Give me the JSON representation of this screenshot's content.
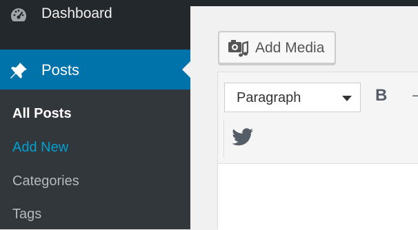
{
  "sidebar": {
    "dashboard": {
      "label": "Dashboard",
      "icon": "dashboard-gauge-icon"
    },
    "posts": {
      "label": "Posts",
      "icon": "pushpin-icon"
    },
    "submenu": [
      {
        "label": "All Posts",
        "state": "current"
      },
      {
        "label": "Add New",
        "state": "hover"
      },
      {
        "label": "Categories",
        "state": "normal"
      },
      {
        "label": "Tags",
        "state": "normal"
      }
    ]
  },
  "editor": {
    "add_media_label": "Add Media",
    "add_media_icon": "media-camera-icon",
    "format_select_value": "Paragraph",
    "bold_label": "B",
    "more_label": "—",
    "twitter_icon": "twitter-icon"
  },
  "colors": {
    "sidebar_bg": "#23282d",
    "submenu_bg": "#32373c",
    "active_blue": "#0073aa",
    "link_blue": "#00a0d2",
    "page_bg": "#f1f1f1"
  }
}
